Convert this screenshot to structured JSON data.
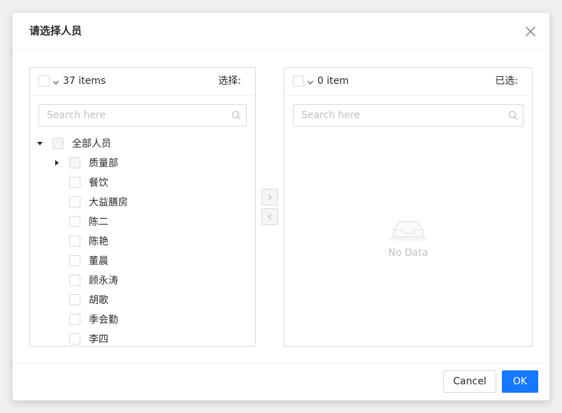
{
  "modal": {
    "title": "请选择人员",
    "close_icon": "close-icon"
  },
  "left_panel": {
    "count": "37 items",
    "title": "选择:",
    "search_placeholder": "Search here",
    "tree": {
      "root": "全部人员",
      "dept": "质量部",
      "people": [
        "餐饮",
        "大益膳房",
        "陈二",
        "陈艳",
        "董晨",
        "顾永涛",
        "胡歌",
        "季会勤",
        "李四"
      ]
    }
  },
  "right_panel": {
    "count": "0 item",
    "title": "已选:",
    "search_placeholder": "Search here",
    "empty_text": "No Data"
  },
  "transfer": {
    "right_arrow": ">",
    "left_arrow": "<"
  },
  "footer": {
    "cancel_label": "Cancel",
    "ok_label": "OK"
  },
  "colors": {
    "primary": "#1677ff",
    "border": "#d9d9d9",
    "placeholder": "#bfbfbf"
  }
}
